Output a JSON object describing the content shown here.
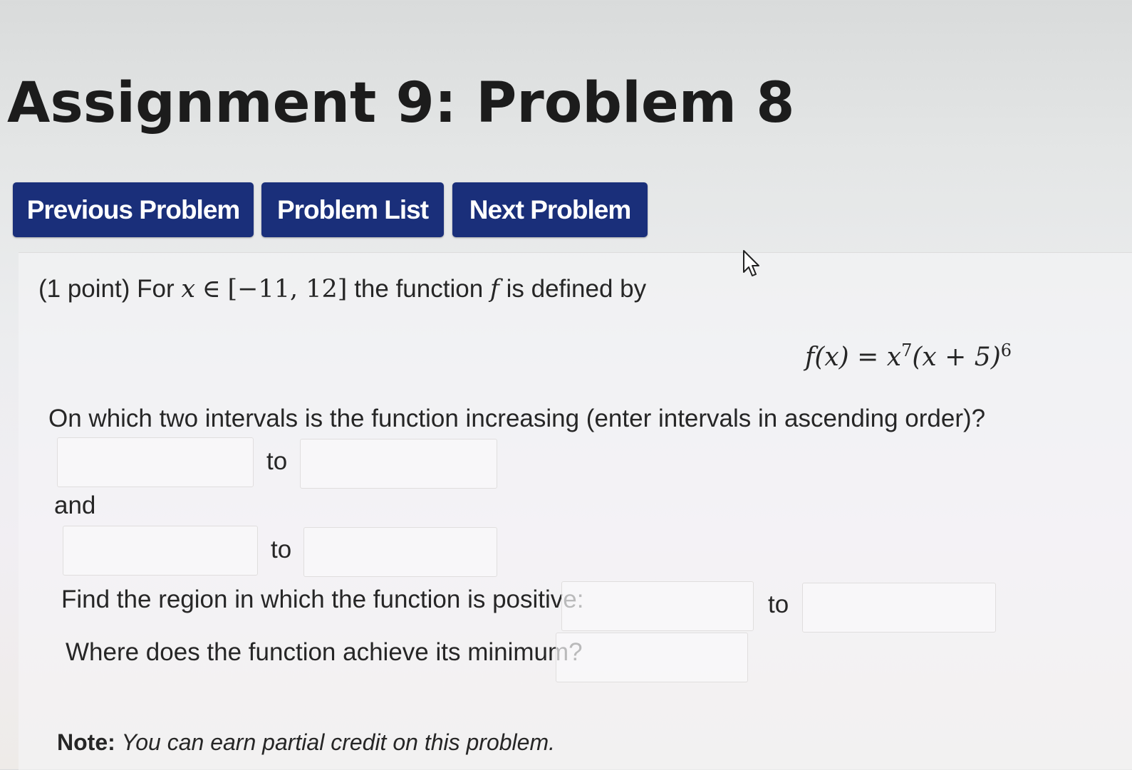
{
  "page": {
    "title": "Assignment 9: Problem 8"
  },
  "nav": {
    "previous_label": "Previous Problem",
    "list_label": "Problem List",
    "next_label": "Next Problem"
  },
  "problem": {
    "intro_prefix": "(1 point) For",
    "var_x": "x",
    "in_symbol": "∈",
    "interval_text": "[−11, 12]",
    "intro_middle": "the function",
    "var_f": "f",
    "intro_suffix": "is defined by",
    "formula": {
      "lhs": "f(x)",
      "equals": "=",
      "base": "x",
      "exp1": "7",
      "factor": "(x + 5)",
      "exp2": "6"
    },
    "q_increasing": "On which two intervals is the function increasing (enter intervals in ascending order)?",
    "to_label": "to",
    "and_label": "and",
    "q_positive": "Find the region in which the function is positive:",
    "q_minimum": "Where does the function achieve its minimum?",
    "note_label": "Note:",
    "note_text": "You can earn partial credit on this problem."
  },
  "answers": {
    "inc1_start": "",
    "inc1_end": "",
    "inc2_start": "",
    "inc2_end": "",
    "positive_start": "",
    "positive_end": "",
    "minimum": ""
  },
  "colors": {
    "button_bg": "#1a2f7a",
    "button_text": "#ffffff"
  },
  "icons": {
    "mouse_cursor": "mouse-pointer-icon"
  }
}
